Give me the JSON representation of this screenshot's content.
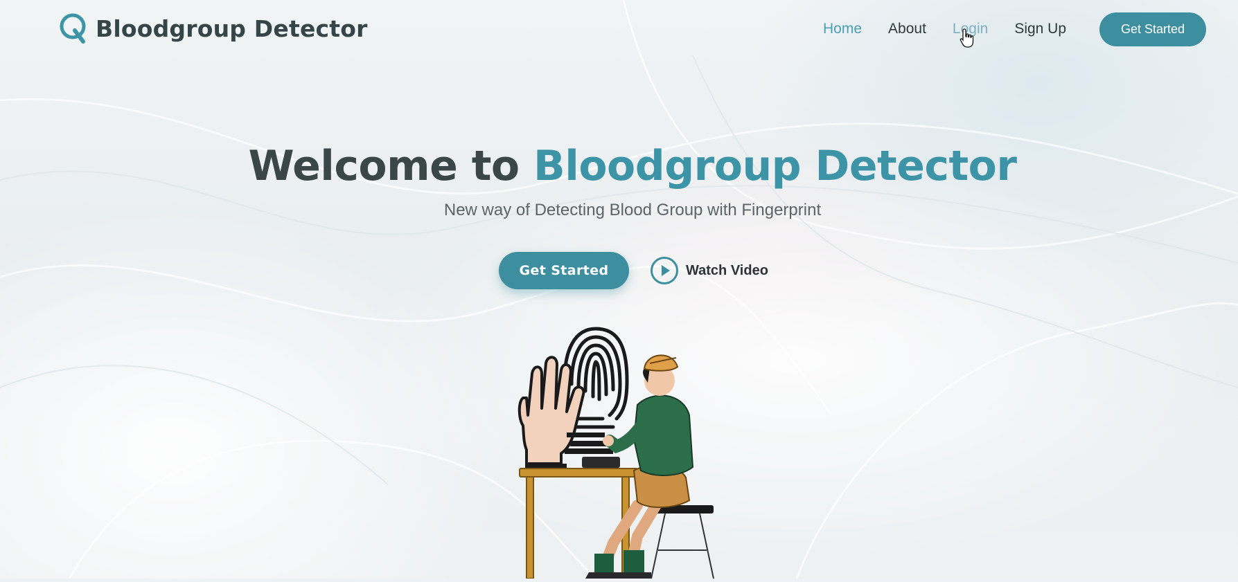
{
  "brand": {
    "name": "Bloodgroup Detector",
    "logo_icon": "q-logo-icon",
    "accent_color": "#3d94a6"
  },
  "nav": {
    "items": [
      {
        "label": "Home",
        "state": "active"
      },
      {
        "label": "About",
        "state": "normal"
      },
      {
        "label": "Login",
        "state": "hover"
      },
      {
        "label": "Sign Up",
        "state": "normal"
      }
    ],
    "cta_label": "Get Started"
  },
  "hero": {
    "title_prefix": "Welcome to",
    "title_accent": "Bloodgroup Detector",
    "subtitle": "New way of Detecting Blood Group with Fingerprint",
    "primary_label": "Get Started",
    "secondary_label": "Watch Video",
    "secondary_icon": "play-icon"
  },
  "colors": {
    "primary": "#3d8e9f",
    "heading": "#3b4648",
    "nav_active": "#4a9fb4"
  }
}
